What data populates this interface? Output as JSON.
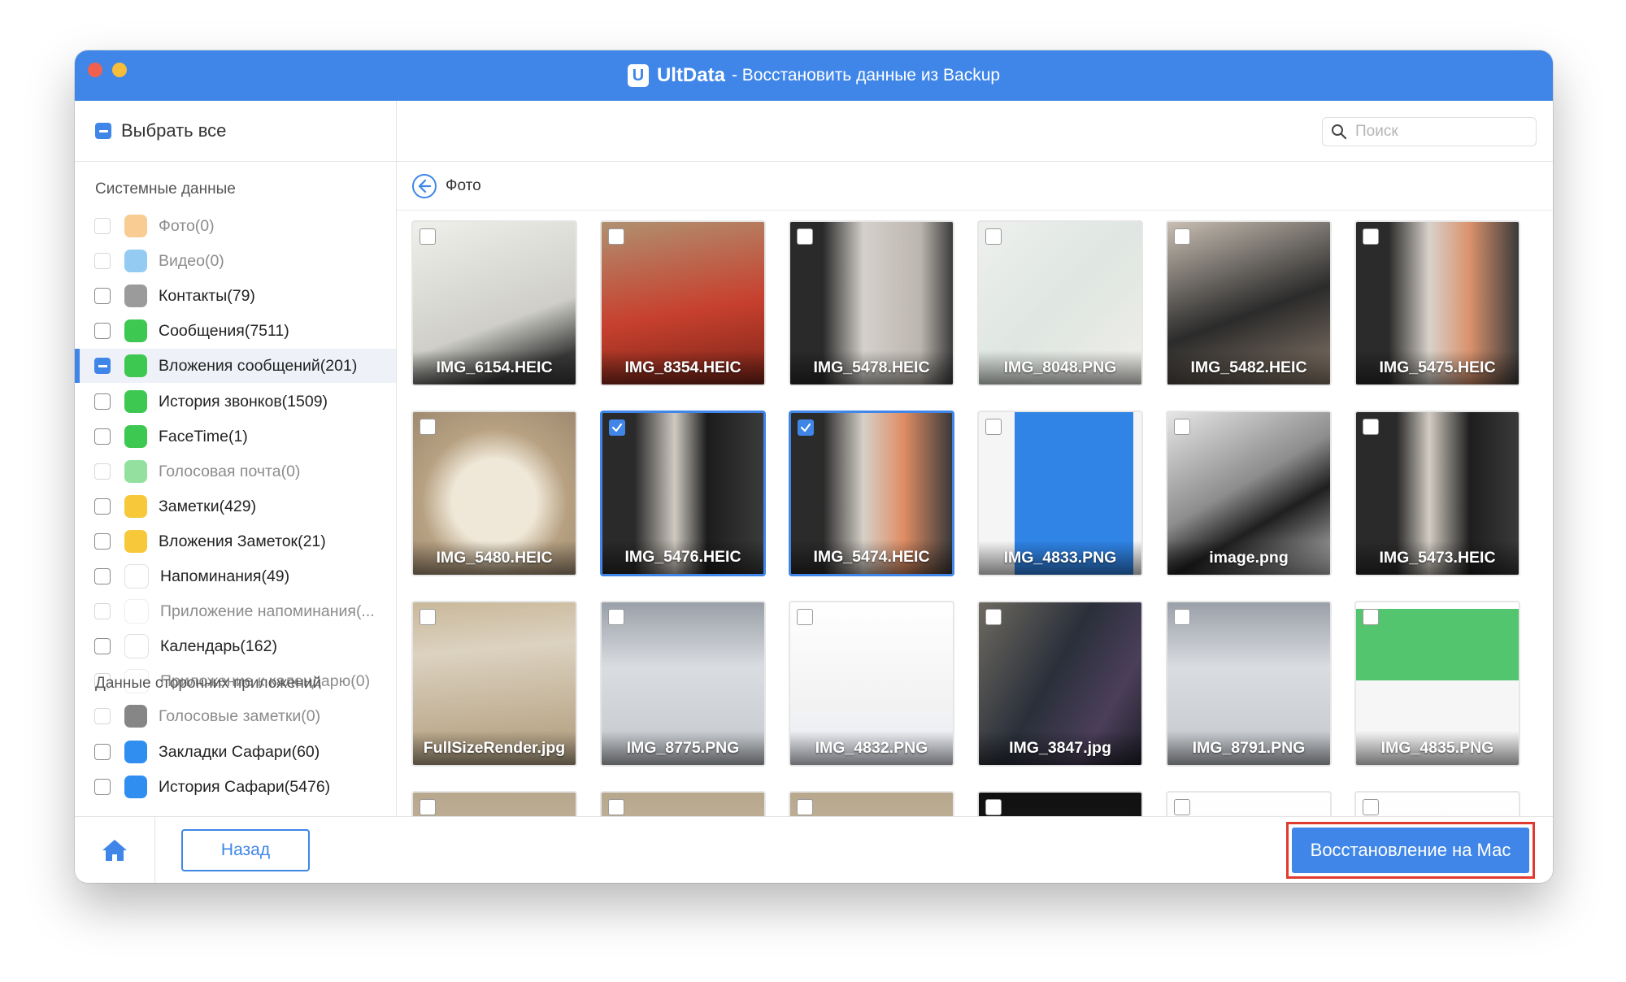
{
  "window": {
    "app_name": "UltData",
    "title_suffix": "- Восстановить данные из Backup",
    "logo_letter": "U"
  },
  "sidebar": {
    "select_all_label": "Выбрать все",
    "section_system": "Системные данные",
    "section_third_party": "Данные сторонних приложений",
    "items": [
      {
        "label": "Фото(0)",
        "icon": "photos-icon",
        "color": "#f2a33a",
        "enabled": false,
        "state": "unchecked"
      },
      {
        "label": "Видео(0)",
        "icon": "video-icon",
        "color": "#3aa0e8",
        "enabled": false,
        "state": "unchecked"
      },
      {
        "label": "Контакты(79)",
        "icon": "contacts-icon",
        "color": "#9b9b9b",
        "enabled": true,
        "state": "unchecked"
      },
      {
        "label": "Сообщения(7511)",
        "icon": "messages-icon",
        "color": "#3dc851",
        "enabled": true,
        "state": "unchecked"
      },
      {
        "label": "Вложения сообщений(201)",
        "icon": "message-attachments-icon",
        "color": "#3dc851",
        "enabled": true,
        "state": "partial",
        "active": true
      },
      {
        "label": "История звонков(1509)",
        "icon": "phone-icon",
        "color": "#3dc851",
        "enabled": true,
        "state": "unchecked"
      },
      {
        "label": "FaceTime(1)",
        "icon": "facetime-icon",
        "color": "#3dc851",
        "enabled": true,
        "state": "unchecked"
      },
      {
        "label": "Голосовая почта(0)",
        "icon": "voicemail-icon",
        "color": "#3dc851",
        "enabled": false,
        "state": "unchecked"
      },
      {
        "label": "Заметки(429)",
        "icon": "notes-icon",
        "color": "#f7c83a",
        "enabled": true,
        "state": "unchecked"
      },
      {
        "label": "Вложения Заметок(21)",
        "icon": "notes-attachments-icon",
        "color": "#f7c83a",
        "enabled": true,
        "state": "unchecked"
      },
      {
        "label": "Напоминания(49)",
        "icon": "reminders-icon",
        "color": "#ffffff",
        "enabled": true,
        "state": "unchecked"
      },
      {
        "label": "Приложение напоминания(...",
        "icon": "reminders-attachments-icon",
        "color": "#ffffff",
        "enabled": false,
        "state": "unchecked"
      },
      {
        "label": "Календарь(162)",
        "icon": "calendar-icon",
        "color": "#ffffff",
        "enabled": true,
        "state": "unchecked"
      },
      {
        "label": "Приложение к календарю(0)",
        "icon": "calendar-attachments-icon",
        "color": "#ffffff",
        "enabled": false,
        "state": "unchecked"
      },
      {
        "label": "Голосовые заметки(0)",
        "icon": "voice-memos-icon",
        "color": "#222222",
        "enabled": false,
        "state": "unchecked"
      },
      {
        "label": "Закладки Сафари(60)",
        "icon": "safari-bookmarks-icon",
        "color": "#2f8ef0",
        "enabled": true,
        "state": "unchecked"
      },
      {
        "label": "История Сафари(5476)",
        "icon": "safari-history-icon",
        "color": "#2f8ef0",
        "enabled": true,
        "state": "unchecked"
      }
    ]
  },
  "main": {
    "search_placeholder": "Поиск",
    "breadcrumb": "Фото",
    "tiles": [
      {
        "name": "IMG_6154.HEIC",
        "checked": false,
        "bg": "linear-gradient(160deg,#efefeb,#cfcfc8 60%,#3a3a3a 85%)"
      },
      {
        "name": "IMG_8354.HEIC",
        "checked": false,
        "bg": "linear-gradient(170deg,#b09070,#c7402e 55%,#7a2418)"
      },
      {
        "name": "IMG_5478.HEIC",
        "checked": false,
        "bg": "linear-gradient(90deg,#2a2a2a 20%,#d4d0cb 45%,#bbb6ae 80%,#3c3c3c)"
      },
      {
        "name": "IMG_8048.PNG",
        "checked": false,
        "bg": "linear-gradient(135deg,#eef0ee,#dfe6e1 50%,#f0eeea)"
      },
      {
        "name": "IMG_5482.HEIC",
        "checked": false,
        "bg": "linear-gradient(160deg,#c9bfb3,#2b2b2b 55%,#8a7a6b)"
      },
      {
        "name": "IMG_5475.HEIC",
        "checked": false,
        "bg": "linear-gradient(90deg,#2b2b2b 20%,#d8d2ca 45%,#d9916c 70%,#3a3a3a)"
      },
      {
        "name": "IMG_5480.HEIC",
        "checked": false,
        "bg": "radial-gradient(circle at 50% 55%,#efe7d7 35%,#b7a182 60%,#a08a70)"
      },
      {
        "name": "IMG_5476.HEIC",
        "checked": true,
        "bg": "linear-gradient(90deg,#2a2a2a 20%,#cfc9c1 45%,#1c1c1c 65%,#3b3b3b)"
      },
      {
        "name": "IMG_5474.HEIC",
        "checked": true,
        "bg": "linear-gradient(90deg,#2b2b2b 20%,#d6d0c8 45%,#df8d63 70%,#3a3a3a)"
      },
      {
        "name": "IMG_4833.PNG",
        "checked": false,
        "bg": "linear-gradient(90deg,#f5f5f5 22%,#2f84e6 22%,#2f84e6 95%,#f5f5f5 95%)"
      },
      {
        "name": "image.png",
        "checked": false,
        "bg": "linear-gradient(150deg,#e6e6e6,#8d8d8d 45%,#1f1f1f 65%,#c2c2c2)"
      },
      {
        "name": "IMG_5473.HEIC",
        "checked": false,
        "bg": "linear-gradient(90deg,#2a2a2a 25%,#d2ccc3 45%,#1e1e1e 70%,#3a3a3a)"
      },
      {
        "name": "FullSizeRender.jpg",
        "checked": false,
        "bg": "linear-gradient(175deg,#c9b89a,#dcd2c0 30%,#bba98c 80%)"
      },
      {
        "name": "IMG_8775.PNG",
        "checked": false,
        "bg": "linear-gradient(180deg,#9aa0a8,#d9dce0 40%,#c3c7cc)"
      },
      {
        "name": "IMG_4832.PNG",
        "checked": false,
        "bg": "linear-gradient(180deg,#ffffff,#f3f3f3 60%,#e8ecf5)"
      },
      {
        "name": "IMG_3847.jpg",
        "checked": false,
        "bg": "linear-gradient(120deg,#6e6a60,#2a2f3a 45%,#4b3f5a 75%,#1f1f28)"
      },
      {
        "name": "IMG_8791.PNG",
        "checked": false,
        "bg": "linear-gradient(180deg,#9aa0a8,#d9dce0 40%,#c3c7cc)"
      },
      {
        "name": "IMG_4835.PNG",
        "checked": false,
        "bg": "linear-gradient(180deg,#ffffff 0%,#ffffff 4%,#52c56e 4%,#52c56e 48%,#f6f6f6 48%)"
      },
      {
        "name": "",
        "checked": false,
        "bg": "linear-gradient(180deg,#b7a78d,#d9cfbe)"
      },
      {
        "name": "",
        "checked": false,
        "bg": "linear-gradient(180deg,#b7a78d,#d9cfbe)"
      },
      {
        "name": "",
        "checked": false,
        "bg": "linear-gradient(180deg,#b7a78d,#d9cfbe)"
      },
      {
        "name": "",
        "checked": false,
        "bg": "linear-gradient(180deg,#111,#222)"
      },
      {
        "name": "",
        "checked": false,
        "bg": "linear-gradient(180deg,#ffffff,#f2f2f2)"
      },
      {
        "name": "",
        "checked": false,
        "bg": "linear-gradient(180deg,#ffffff,#f2f2f2)"
      }
    ]
  },
  "footer": {
    "back_label": "Назад",
    "recover_label": "Восстановление на Мас"
  },
  "colors": {
    "accent": "#3f86e8",
    "highlight_border": "#e03a2f"
  }
}
